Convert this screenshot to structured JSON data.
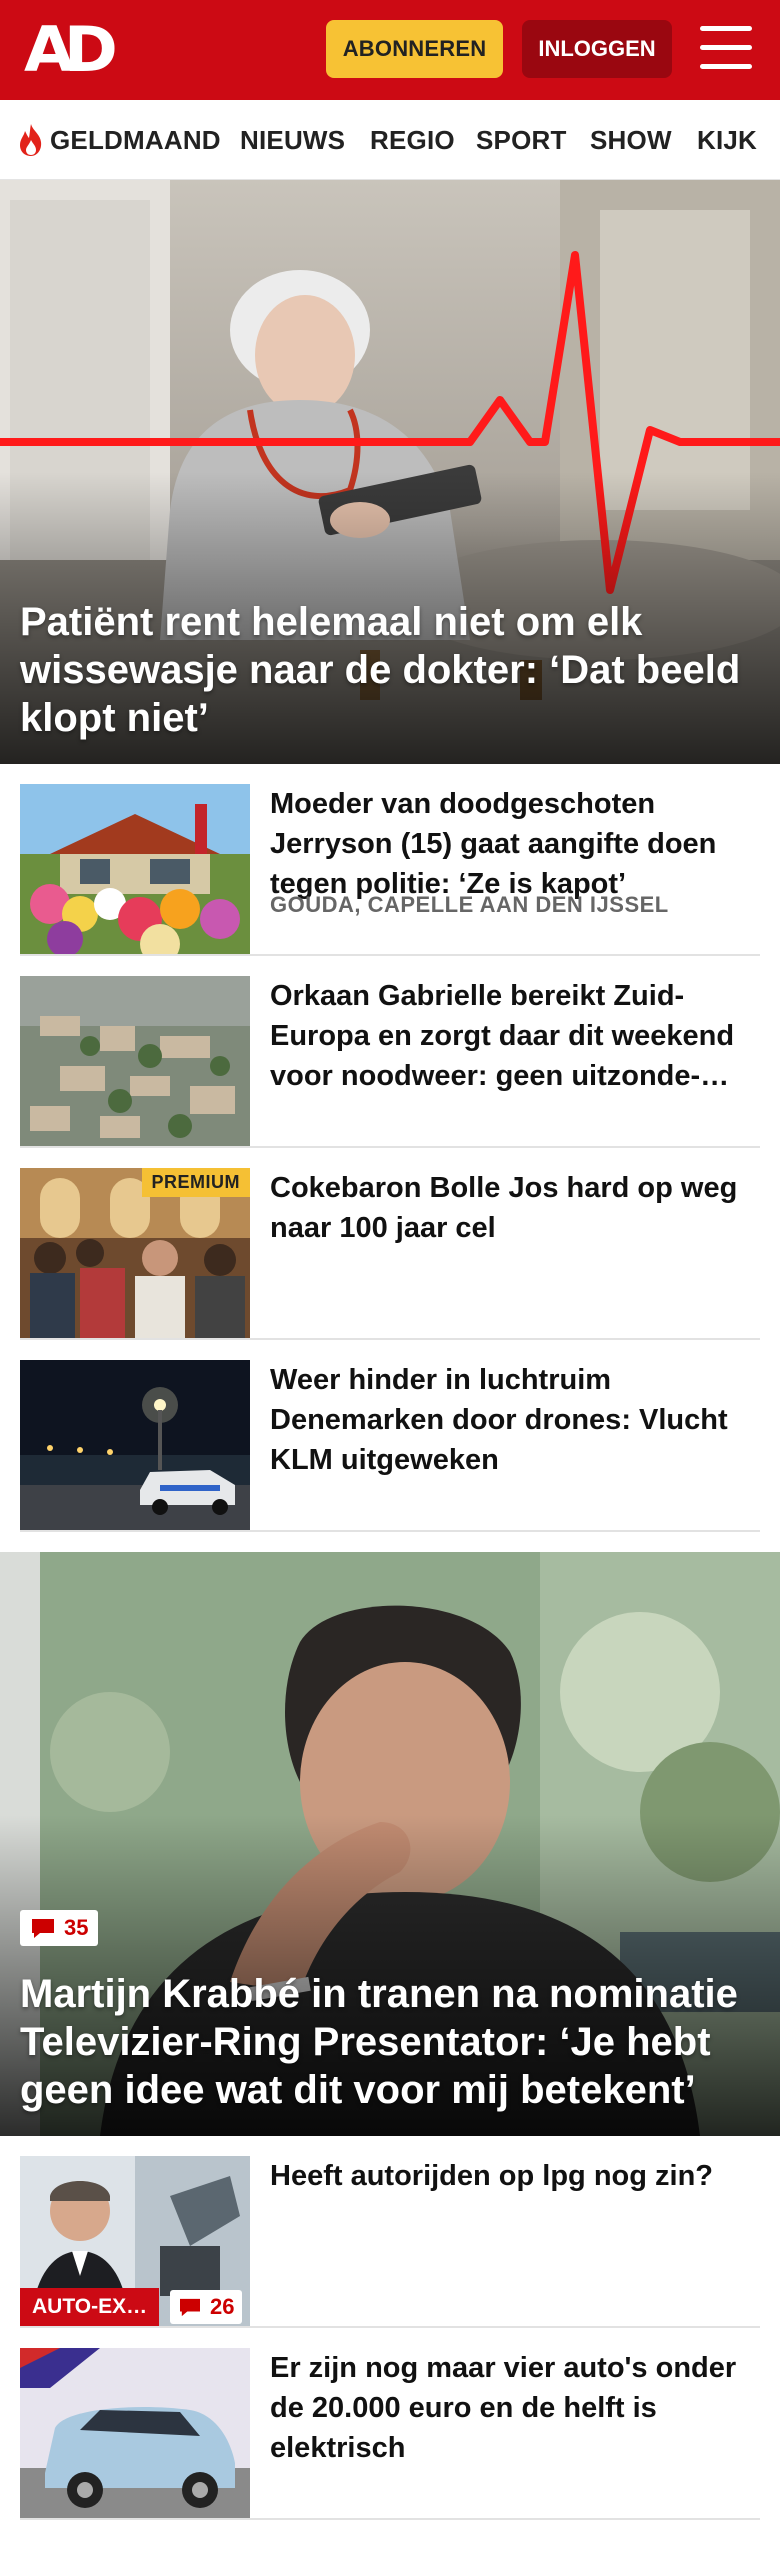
{
  "header": {
    "logo": "AD",
    "subscribe_label": "ABONNEREN",
    "login_label": "INLOGGEN",
    "brand_color": "#cc0a14",
    "subscribe_color": "#f7c234",
    "menu_icon": "hamburger-icon"
  },
  "nav": {
    "items": [
      "GELDMAAND",
      "NIEUWS",
      "REGIO",
      "SPORT",
      "SHOW",
      "KIJK"
    ],
    "first_icon": "flame-icon"
  },
  "hero_top": {
    "title": "Patiënt rent helemaal niet om elk wissewasje naar de dokter: ‘Dat beeld klopt niet’"
  },
  "articles": [
    {
      "title": "Moeder van doodgeschoten Jerryson (15) gaat aangifte doen tegen politie: ‘Ze is kapot’",
      "location": "GOUDA, CAPELLE AAN DEN IJSSEL"
    },
    {
      "title": "Orkaan Gabrielle bereikt Zuid-Europa en zorgt daar dit weekend voor noodweer: geen uitzonde-…"
    },
    {
      "title": "Cokebaron Bolle Jos hard op weg naar 100 jaar cel",
      "badge": "PREMIUM"
    },
    {
      "title": "Weer hinder in luchtruim Denemarken door drones: Vlucht KLM uitgeweken"
    }
  ],
  "hero_second": {
    "title": "Martijn Krabbé in tranen na nominatie Televizier-Ring Presentator: ‘Je hebt geen idee wat dit voor mij betekent’",
    "comments": "35"
  },
  "articles_bottom": [
    {
      "title": "Heeft autorijden op lpg nog zin?",
      "tag": "AUTO-EX…",
      "comments": "26"
    },
    {
      "title": "Er zijn nog maar vier auto's onder de 20.000 euro en de helft is elektrisch"
    }
  ]
}
